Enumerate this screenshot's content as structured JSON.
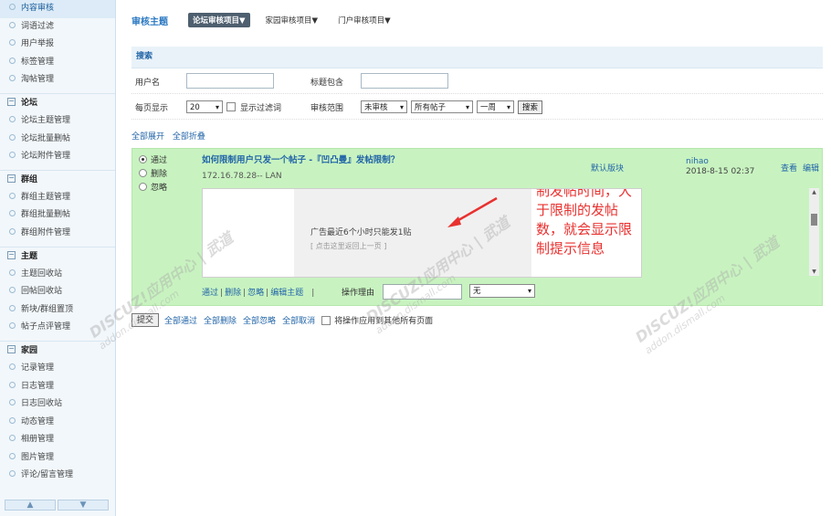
{
  "sidebar": {
    "top_items": [
      "内容审核",
      "词语过滤",
      "用户举报",
      "标签管理",
      "淘帖管理"
    ],
    "groups": [
      {
        "title": "论坛",
        "items": [
          "论坛主题管理",
          "论坛批量删帖",
          "论坛附件管理"
        ]
      },
      {
        "title": "群组",
        "items": [
          "群组主题管理",
          "群组批量删帖",
          "群组附件管理"
        ]
      },
      {
        "title": "主题",
        "items": [
          "主题回收站",
          "回帖回收站",
          "新块/群组置顶",
          "帖子点评管理"
        ]
      },
      {
        "title": "家园",
        "items": [
          "记录管理",
          "日志管理",
          "日志回收站",
          "动态管理",
          "相册管理",
          "图片管理",
          "评论/留言管理"
        ]
      }
    ],
    "scroll_up": "▲",
    "scroll_down": "▼"
  },
  "header": {
    "title": "审核主题",
    "tabs": [
      "论坛审核项目▼",
      "家园审核项目▼",
      "门户审核项目▼"
    ]
  },
  "search": {
    "heading": "搜索",
    "username_label": "用户名",
    "title_contains_label": "标题包含",
    "per_page_label": "每页显示",
    "per_page_value": "20",
    "show_filter_label": "显示过滤词",
    "audit_scope_label": "审核范围",
    "status_value": "未审核",
    "posts_value": "所有帖子",
    "period_value": "一周",
    "search_button": "搜索"
  },
  "links": {
    "expand_all": "全部展开",
    "collapse_all": "全部折叠"
  },
  "thread": {
    "radios": [
      "通过",
      "删除",
      "忽略"
    ],
    "title": "如何限制用户只发一个帖子 -『凹凸曼』发帖限制？",
    "ip": "172.16.78.28-- LAN",
    "forum": "默认版块",
    "author": "nihao",
    "time": "2018-8-15 02:37",
    "view": "查看",
    "edit": "编辑",
    "content_msg": "广告最近6个小时只能发1贴",
    "content_back": "[ 点击这里返回上一页 ]",
    "annotation": "制发帖时间，大于限制的发帖数，就会显示限制提示信息",
    "actions": [
      "通过",
      "删除",
      "忽略",
      "编辑主题"
    ],
    "reason_label": "操作理由",
    "reason_select": "无"
  },
  "footer": {
    "submit": "提交",
    "links": [
      "全部通过",
      "全部删除",
      "全部忽略",
      "全部取消"
    ],
    "apply_all": "将操作应用到其他所有页面"
  },
  "watermark": {
    "brand": "DISCUZ!应用中心 | 武道",
    "domain": "addon.dismall.com"
  }
}
